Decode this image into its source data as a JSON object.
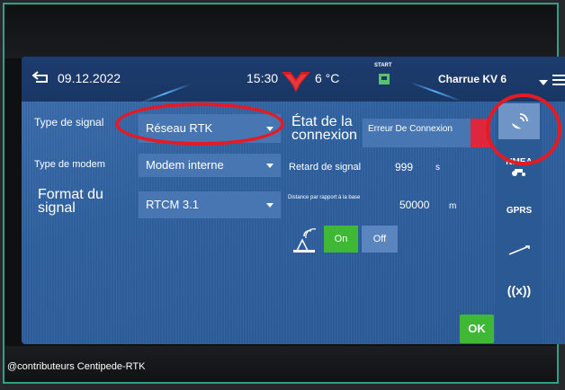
{
  "header": {
    "date": "09.12.2022",
    "time": "15:30",
    "temperature": "6 °C",
    "start_label": "START",
    "implement": "Charrue KV 6"
  },
  "form": {
    "signal_type_label": "Type de signal",
    "signal_type_value": "Réseau RTK",
    "modem_type_label": "Type de modem",
    "modem_type_value": "Modem interne",
    "signal_format_label": "Format du signal",
    "signal_format_value": "RTCM 3.1",
    "connection_state_label": "État de la connexion",
    "connection_state_value": "Erreur De Connexion",
    "signal_delay_label": "Retard de signal",
    "signal_delay_value": "999",
    "signal_delay_unit": "s",
    "base_distance_label": "Distance par rapport à la base",
    "base_distance_value": "50000",
    "base_distance_unit": "m",
    "toggle_on": "On",
    "toggle_off": "Off"
  },
  "sidebar": {
    "items": [
      {
        "icon": "satellite-dish-icon"
      },
      {
        "label": "NMEA",
        "icon": "tractor-icon"
      },
      {
        "label": "GPRS"
      },
      {
        "icon": "signal-slope-icon"
      },
      {
        "label": "((x))",
        "icon": "broadcast-icon"
      }
    ]
  },
  "ok_label": "OK",
  "watermark": "@contributeurs Centipede-RTK",
  "colors": {
    "screen_bg": "#2f5f9e",
    "topbar_bg": "#1a3764",
    "field_bg": "#4876b3",
    "on_green": "#3fb836",
    "error_red": "#e0263c",
    "highlight_red": "#e41b23",
    "frame_border": "#2ba386"
  }
}
